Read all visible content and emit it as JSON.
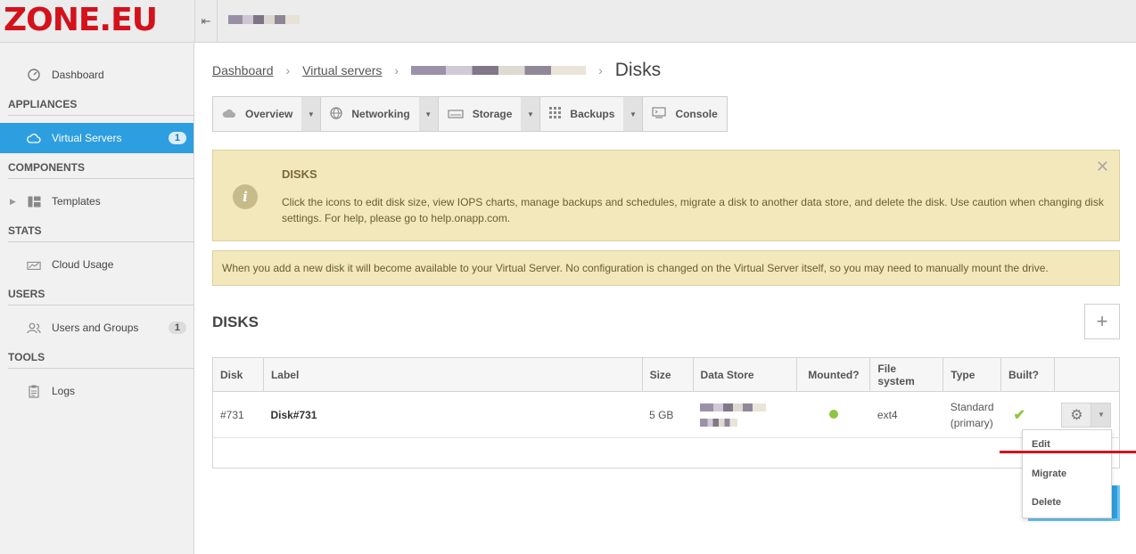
{
  "header": {
    "logo_text": "ZONE.EU",
    "collapse_icon": "collapse-left-icon"
  },
  "sidebar": {
    "dashboard": {
      "label": "Dashboard",
      "icon": "dashboard-icon"
    },
    "sections": {
      "appliances": "APPLIANCES",
      "components": "COMPONENTS",
      "stats": "STATS",
      "users": "USERS",
      "tools": "TOOLS"
    },
    "virtual_servers": {
      "label": "Virtual Servers",
      "badge": "1",
      "icon": "cloud-icon"
    },
    "templates": {
      "label": "Templates",
      "icon": "templates-icon"
    },
    "cloud_usage": {
      "label": "Cloud Usage",
      "icon": "chart-icon"
    },
    "users_groups": {
      "label": "Users and Groups",
      "badge": "1",
      "icon": "users-icon"
    },
    "logs": {
      "label": "Logs",
      "icon": "clipboard-icon"
    }
  },
  "breadcrumb": {
    "dashboard": "Dashboard",
    "virtual_servers": "Virtual servers",
    "current": "Disks"
  },
  "tabs": {
    "overview": "Overview",
    "networking": "Networking",
    "storage": "Storage",
    "backups": "Backups",
    "console": "Console"
  },
  "alert": {
    "title": "DISKS",
    "text": "Click the icons to edit disk size, view IOPS charts, manage backups and schedules, migrate a disk to another data store, and delete the disk. Use caution when changing disk settings. For help, please go to help.onapp.com."
  },
  "note": "When you add a new disk it will become available to your Virtual Server. No configuration is changed on the Virtual Server itself, so you may need to manually mount the drive.",
  "disks": {
    "title": "DISKS",
    "add_label": "+",
    "columns": [
      "Disk",
      "Label",
      "Size",
      "Data Store",
      "Mounted?",
      "File system",
      "Type",
      "Built?",
      ""
    ],
    "rows": [
      {
        "disk": "#731",
        "label": "Disk#731",
        "size": "5 GB",
        "mounted": true,
        "file_system": "ext4",
        "type": "Standard",
        "type_note": "(primary)",
        "built": true
      }
    ]
  },
  "dropdown": {
    "edit": "Edit",
    "migrate": "Migrate",
    "delete": "Delete"
  },
  "colors": {
    "brand_red": "#d3121c",
    "active_blue": "#2d9ee0",
    "alert_bg": "#f2e8bc",
    "success_green": "#8dc63f"
  }
}
